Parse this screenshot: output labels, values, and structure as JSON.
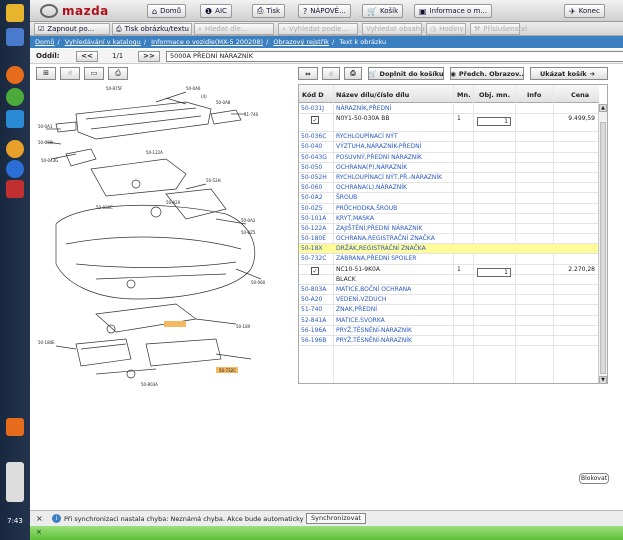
{
  "app": {
    "logo_text": "mazda",
    "clock": "7:43"
  },
  "toolbar1": {
    "home": "Domů",
    "aic": "AIC",
    "print": "Tisk",
    "help": "NÁPOVĚ...",
    "cart": "Košík",
    "info": "Informace o m...",
    "exit": "Konec"
  },
  "toolbar2": {
    "save_po": "Zapnout po...",
    "print_img": "Tisk obrázku/textu",
    "b3": "Hledat dle...",
    "b4": "Vyhledat podle...",
    "b5": "Vyhledat obsahu",
    "b6": "Hodiny",
    "b7": "Příslušenství"
  },
  "breadcrumb": {
    "home": "Domů",
    "catalog": "Vyhledávání v katalogu",
    "vehicle": "Informace o vozidle(MX-5 200208)",
    "register": "Obrazový rejstřík",
    "current": "Text k obrázku"
  },
  "section": {
    "label": "Oddíl:",
    "prev": "<<",
    "page": "1/1",
    "next": ">>",
    "value": "5000A PŘEDNÍ NÁRAZNÍK"
  },
  "right_toolbar": {
    "add_cart": "Doplnit do košíku",
    "prev_img": "Předch. Obrazov..",
    "show_cart": "Ukázat košík"
  },
  "table": {
    "headers": {
      "code": "Kód D",
      "name": "Název dílu/číslo dílu",
      "mn": "Mn.",
      "obj": "Obj. mn.",
      "info": "Info",
      "price": "Cena"
    },
    "rows": [
      {
        "code": "50-031J",
        "name": "NÁRAZNÍK,PŘEDNÍ"
      },
      {
        "check": "✓",
        "name": "N0Y1-50-030A BB",
        "mn": "1",
        "obj": "1",
        "price": "9.499,59",
        "tall": true
      },
      {
        "code": "50-036C",
        "name": "RYCHLOUPÍNACÍ NÝT"
      },
      {
        "code": "50-040",
        "name": "VÝZTUHA,NÁRAZNÍK-PŘEDNÍ"
      },
      {
        "code": "50-043G",
        "name": "POSUVNÝ,PŘEDNÍ NÁRAZNÍK"
      },
      {
        "code": "50-050",
        "name": "OCHRANA(P),NÁRAZNÍK"
      },
      {
        "code": "50-052H",
        "name": "RYCHLOUPÍNACÍ NÝT,PŘ.-NÁRAZNÍK"
      },
      {
        "code": "50-060",
        "name": "OCHRANA(L),NÁRAZNÍK"
      },
      {
        "code": "50-0A2",
        "name": "ŠROUB"
      },
      {
        "code": "50-0Z5",
        "name": "PRŮCHODKA,ŠROUB"
      },
      {
        "code": "50-101A",
        "name": "KRYT,MASKA"
      },
      {
        "code": "50-122A",
        "name": "ZAJIŠTĚNÍ,PŘEDNÍ NÁRAZNÍK"
      },
      {
        "code": "50-180E",
        "name": "OCHRANA,REGISTRAČNÍ ZNAČKA"
      },
      {
        "code": "50-18X",
        "name": "DRŽÁK,REGISTRAČNÍ ZNAČKA",
        "selected": true
      },
      {
        "code": "50-732C",
        "name": "ZÁBRANA,PŘEDNÍ SPOILER"
      },
      {
        "check": "✓",
        "name": "NC10-51-9K0A",
        "mn": "1",
        "obj": "1",
        "price": "2.270,28"
      },
      {
        "name": "BLACK",
        "dark": true
      },
      {
        "code": "50-803A",
        "name": "MATICE,BOČNÍ OCHRANA"
      },
      {
        "code": "50-A20",
        "name": "VEDENÍ,VZDUCH"
      },
      {
        "code": "51-740",
        "name": "ZNAK,PŘEDNÍ"
      },
      {
        "code": "52-841A",
        "name": "MATICE,SVORKA"
      },
      {
        "code": "56-196A",
        "name": "PRYŽ,TĚSNĚNÍ-NÁRAZNÍK"
      },
      {
        "code": "56-196B",
        "name": "PRYŽ,TĚSNĚNÍ-NÁRAZNÍK"
      }
    ]
  },
  "blokovat": "Blokovat",
  "status": {
    "message": "Při synchronizaci nastala chyba: Neznámá chyba. Akce bude automaticky opakována.",
    "sync_button": "Synchronizovat"
  },
  "diagram_labels": [
    "50-875F",
    "50-0A6",
    "(4)",
    "50-0A8",
    "51-740",
    "50-0A1",
    "50-030(-",
    "50-043G",
    "50-122A",
    "50-036C",
    "50-52H",
    "50-A20",
    "50-0A2",
    "50-0Z5",
    "50-060",
    "50-180E",
    "50-18X",
    "50-732C",
    "50-803A"
  ],
  "colors": {
    "accent_blue": "#3a7fc0",
    "link": "#2b59c3",
    "selected_row": "#fffb9a",
    "brand_red": "#b0101c"
  }
}
